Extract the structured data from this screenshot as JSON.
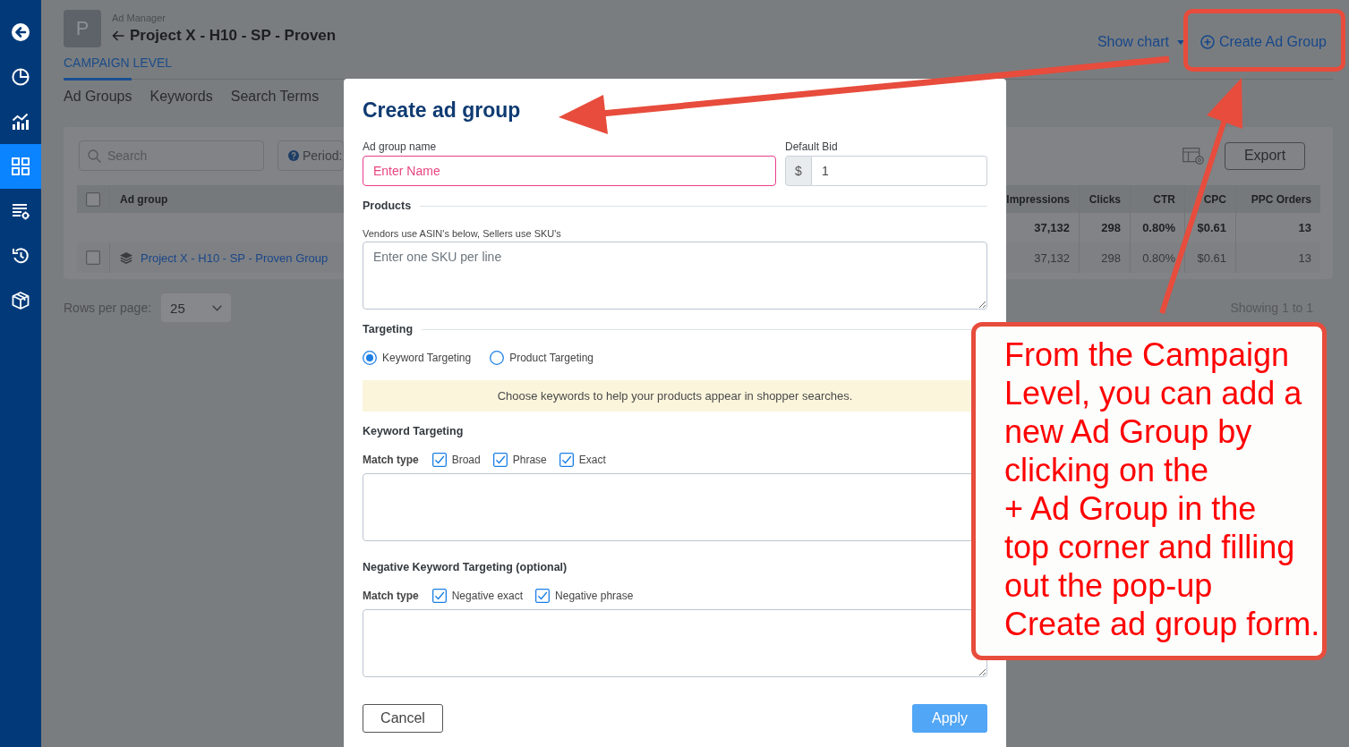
{
  "sidebar": {
    "items": [
      {
        "selected": false
      },
      {
        "selected": false
      },
      {
        "selected": false
      },
      {
        "selected": true
      },
      {
        "selected": false
      },
      {
        "selected": false
      },
      {
        "selected": false
      }
    ]
  },
  "header": {
    "avatar": "P",
    "breadcrumb": "Ad Manager",
    "title": "Project X - H10 - SP - Proven",
    "level": "CAMPAIGN LEVEL",
    "show_chart": "Show chart",
    "create_button": "Create Ad Group"
  },
  "tabs": [
    {
      "label": "Ad Groups",
      "selected": true
    },
    {
      "label": "Keywords",
      "selected": false
    },
    {
      "label": "Search Terms",
      "selected": false
    }
  ],
  "toolbar": {
    "search": {
      "placeholder": "Search"
    },
    "period": "Period:",
    "export": "Export"
  },
  "table": {
    "header_checked": false,
    "columns": [
      "Ad group",
      "Impressions",
      "Clicks",
      "CTR",
      "CPC",
      "PPC Orders"
    ],
    "rows": [
      {
        "kind": "total",
        "values": [
          "37,132",
          "298",
          "0.80%",
          "$0.61",
          "13"
        ]
      },
      {
        "kind": "group",
        "checked": false,
        "name": "Project X - H10 - SP - Proven Group",
        "values": [
          "37,132",
          "298",
          "0.80%",
          "$0.61",
          "13"
        ]
      }
    ]
  },
  "footer": {
    "rows_label": "Rows per page:",
    "rows_value": "25",
    "showing": "Showing 1 to 1"
  },
  "modal": {
    "title": "Create ad group",
    "name_field": {
      "label": "Ad group name",
      "placeholder": "Enter Name",
      "invalid": true
    },
    "bid_field": {
      "label": "Default Bid",
      "prefix": "$",
      "value": "1"
    },
    "products": {
      "heading": "Products",
      "hint": "Vendors use ASIN's below, Sellers use SKU's",
      "placeholder": "Enter one SKU per line"
    },
    "targeting": {
      "heading": "Targeting",
      "options": [
        {
          "label": "Keyword Targeting",
          "selected": true
        },
        {
          "label": "Product Targeting",
          "selected": false
        }
      ],
      "notice": "Choose keywords to help your products appear in shopper searches."
    },
    "keyword_targeting": {
      "heading": "Keyword Targeting",
      "match_label": "Match type",
      "options": [
        {
          "label": "Broad",
          "checked": true
        },
        {
          "label": "Phrase",
          "checked": true
        },
        {
          "label": "Exact",
          "checked": true
        }
      ]
    },
    "negative_targeting": {
      "heading": "Negative Keyword Targeting (optional)",
      "match_label": "Match type",
      "options": [
        {
          "label": "Negative exact",
          "checked": true
        },
        {
          "label": "Negative phrase",
          "checked": true
        }
      ]
    },
    "buttons": [
      {
        "label": "Cancel",
        "kind": "secondary"
      },
      {
        "label": "Apply",
        "kind": "primary"
      }
    ]
  },
  "callout": {
    "lines": [
      "From the Campaign",
      "Level, you can add a",
      "new Ad Group by",
      "clicking on the",
      "+ Ad Group in the",
      "top corner and filling",
      "out the pop-up",
      "Create ad group form."
    ]
  }
}
